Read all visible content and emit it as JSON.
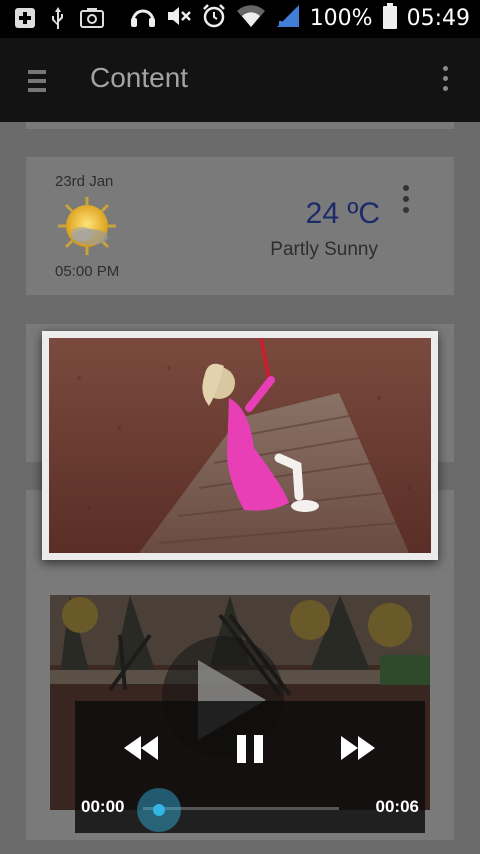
{
  "status_bar": {
    "battery_percent": "100%",
    "time": "05:49",
    "icons": [
      "add-icon",
      "usb-icon",
      "screenshot-icon",
      "headphones-icon",
      "mute-icon",
      "alarm-icon",
      "wifi-icon",
      "signal-icon",
      "battery-icon"
    ]
  },
  "action_bar": {
    "title": "Content",
    "menu_icon": "hamburger-icon",
    "overflow_icon": "overflow-menu-icon"
  },
  "weather_card": {
    "date": "23rd Jan",
    "time": "05:00 PM",
    "temperature": "24 ºC",
    "condition": "Partly Sunny",
    "icon": "partly-sunny-icon"
  },
  "photo": {
    "description_icon": "photo-thumbnail"
  },
  "video_player": {
    "current_time": "00:00",
    "duration": "00:06",
    "progress": 0.0,
    "accent_color": "#33b5e5"
  },
  "colors": {
    "status_bar_bg": "#000000",
    "action_bar_bg": "#131313",
    "temperature_text": "#1b2a6b"
  }
}
